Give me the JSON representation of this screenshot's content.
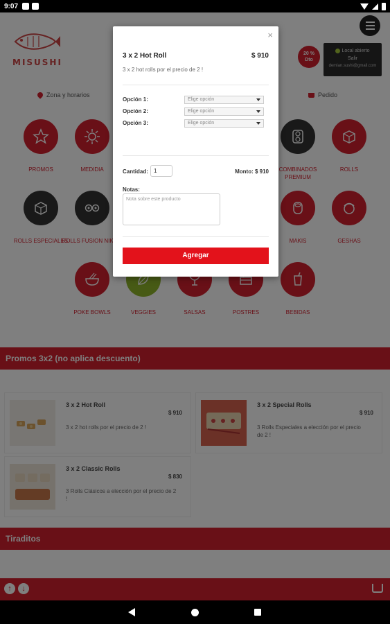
{
  "status_bar": {
    "time": "9:07"
  },
  "header": {
    "logo_text": "MISUSHI",
    "discount": {
      "line1": "20 %",
      "line2": "Dto"
    },
    "store_status": {
      "line1": "Local abierto",
      "line2": "Salir",
      "email": "demian.sushi@gmail.com"
    }
  },
  "nav": {
    "zone_label": "Zona y horarios",
    "order_label": "Pedido"
  },
  "categories": [
    {
      "label": "PROMOS",
      "icon": "star-icon"
    },
    {
      "label": "MEDIDIA",
      "icon": "sun-icon"
    },
    {
      "label": "COMBINADOS PREMIUM",
      "icon": "sushi-roll-icon"
    },
    {
      "label": "ROLLS",
      "icon": "roll-icon"
    },
    {
      "label": "ROLLS ESPECIALES",
      "icon": "special-roll-icon"
    },
    {
      "label": "ROLLS FUSION NIKKEI",
      "icon": "fusion-roll-icon"
    },
    {
      "label": "MAKIS",
      "icon": "maki-icon"
    },
    {
      "label": "GESHAS",
      "icon": "geisha-icon"
    },
    {
      "label": "POKE BOWLS",
      "icon": "bowl-icon"
    },
    {
      "label": "VEGGIES",
      "icon": "leaf-icon"
    },
    {
      "label": "SALSAS",
      "icon": "sauce-icon"
    },
    {
      "label": "POSTRES",
      "icon": "dessert-icon"
    },
    {
      "label": "BEBIDAS",
      "icon": "drink-icon"
    }
  ],
  "sections": [
    {
      "title": "Promos 3x2 (no aplica descuento)"
    },
    {
      "title": "Tiraditos"
    }
  ],
  "products": [
    {
      "title": "3 x 2 Hot Roll",
      "price": "$ 910",
      "desc": "3 x 2 hot rolls por el precio de 2 !"
    },
    {
      "title": "3 x 2 Special Rolls",
      "price": "$ 910",
      "desc": "3 Rolls Especiales a elección por el precio de 2 !"
    },
    {
      "title": "3 x 2 Classic Rolls",
      "price": "$ 830",
      "desc": "3 Rolls Clásicos a elección por el precio de 2 !"
    }
  ],
  "modal": {
    "close": "×",
    "title": "3 x 2 Hot Roll",
    "price": "$ 910",
    "description": "3 x 2 hot rolls por el precio de 2 !",
    "options": [
      {
        "label": "Opción 1:",
        "value": "Elige opción"
      },
      {
        "label": "Opción 2:",
        "value": "Elige opción"
      },
      {
        "label": "Opción 3:",
        "value": "Elige opción"
      }
    ],
    "quantity_label": "Cantidad:",
    "quantity_value": "1",
    "monto": "Monto:  $ 910",
    "notes_label": "Notas:",
    "notes_placeholder": "Nota sobre este producto",
    "add_button": "Agregar"
  },
  "colors": {
    "brand_red": "#d3202e",
    "button_red": "#e3121b",
    "dark": "#333333",
    "veggie_green": "#8fb42a"
  }
}
